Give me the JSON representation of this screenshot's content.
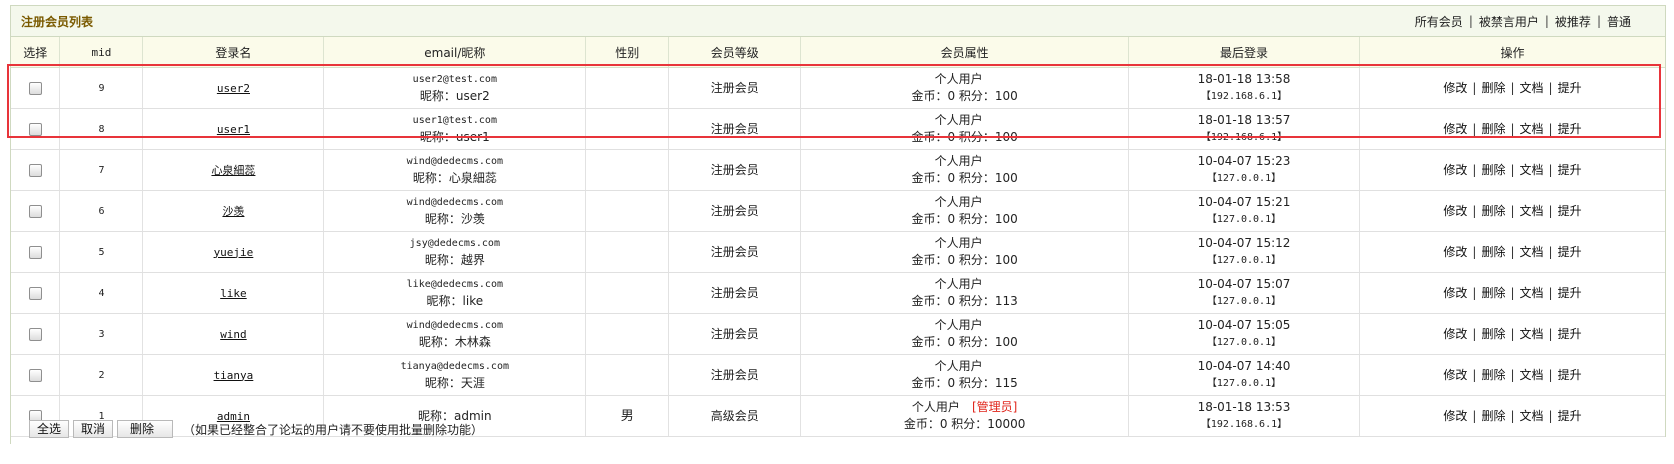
{
  "title": "注册会员列表",
  "filters": [
    "所有会员",
    "被禁言用户",
    "被推荐",
    "普通"
  ],
  "columns": [
    "选择",
    "mid",
    "登录名",
    "email/昵称",
    "性别",
    "会员等级",
    "会员属性",
    "最后登录",
    "操作"
  ],
  "ops": [
    "修改",
    "删除",
    "文档",
    "提升"
  ],
  "rows": [
    {
      "mid": "9",
      "login": "user2",
      "email": "user2@test.com",
      "nick": "昵称：user2",
      "gender": "",
      "level": "注册会员",
      "attr": "个人用户",
      "admin_tag": "",
      "points": "金币：0 积分：100",
      "last_time": "18-01-18 13:58",
      "last_ip": "【192.168.6.1】"
    },
    {
      "mid": "8",
      "login": "user1",
      "email": "user1@test.com",
      "nick": "昵称：user1",
      "gender": "",
      "level": "注册会员",
      "attr": "个人用户",
      "admin_tag": "",
      "points": "金币：0 积分：100",
      "last_time": "18-01-18 13:57",
      "last_ip": "【192.168.6.1】"
    },
    {
      "mid": "7",
      "login": "心泉細蕊",
      "email": "wind@dedecms.com",
      "nick": "昵称：心泉細蕊",
      "gender": "",
      "level": "注册会员",
      "attr": "个人用户",
      "admin_tag": "",
      "points": "金币：0 积分：100",
      "last_time": "10-04-07 15:23",
      "last_ip": "【127.0.0.1】"
    },
    {
      "mid": "6",
      "login": "沙羡",
      "email": "wind@dedecms.com",
      "nick": "昵称：沙羡",
      "gender": "",
      "level": "注册会员",
      "attr": "个人用户",
      "admin_tag": "",
      "points": "金币：0 积分：100",
      "last_time": "10-04-07 15:21",
      "last_ip": "【127.0.0.1】"
    },
    {
      "mid": "5",
      "login": "yuejie",
      "email": "jsy@dedecms.com",
      "nick": "昵称：越界",
      "gender": "",
      "level": "注册会员",
      "attr": "个人用户",
      "admin_tag": "",
      "points": "金币：0 积分：100",
      "last_time": "10-04-07 15:12",
      "last_ip": "【127.0.0.1】"
    },
    {
      "mid": "4",
      "login": "like",
      "email": "like@dedecms.com",
      "nick": "昵称：like",
      "gender": "",
      "level": "注册会员",
      "attr": "个人用户",
      "admin_tag": "",
      "points": "金币：0 积分：113",
      "last_time": "10-04-07 15:07",
      "last_ip": "【127.0.0.1】"
    },
    {
      "mid": "3",
      "login": "wind",
      "email": "wind@dedecms.com",
      "nick": "昵称：木林森",
      "gender": "",
      "level": "注册会员",
      "attr": "个人用户",
      "admin_tag": "",
      "points": "金币：0 积分：100",
      "last_time": "10-04-07 15:05",
      "last_ip": "【127.0.0.1】"
    },
    {
      "mid": "2",
      "login": "tianya",
      "email": "tianya@dedecms.com",
      "nick": "昵称：天涯",
      "gender": "",
      "level": "注册会员",
      "attr": "个人用户",
      "admin_tag": "",
      "points": "金币：0 积分：115",
      "last_time": "10-04-07 14:40",
      "last_ip": "【127.0.0.1】"
    },
    {
      "mid": "1",
      "login": "admin",
      "email": "",
      "nick": "昵称：admin",
      "gender": "男",
      "level": "高级会员",
      "attr": "个人用户",
      "admin_tag": "[管理员]",
      "points": "金币：0 积分：10000",
      "last_time": "18-01-18 13:53",
      "last_ip": "【192.168.6.1】"
    }
  ],
  "footer": {
    "select_all": "全选",
    "cancel": "取消",
    "delete": "删除",
    "note": "（如果已经整合了论坛的用户请不要使用批量删除功能）"
  }
}
